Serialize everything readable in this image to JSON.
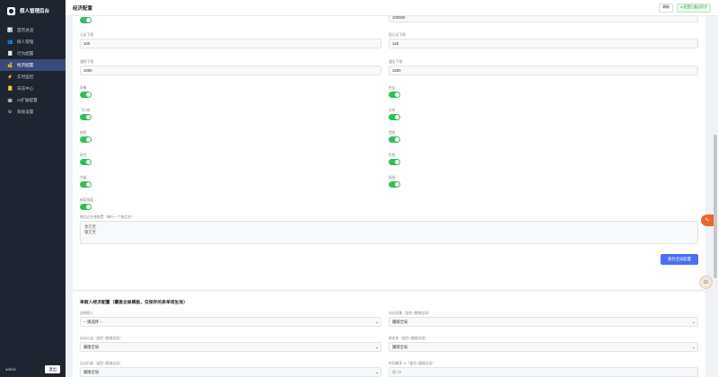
{
  "sidebar": {
    "brand": "假人管理后台",
    "items": [
      {
        "icon": "📊",
        "label": "首页总览"
      },
      {
        "icon": "👥",
        "label": "假人管理"
      },
      {
        "icon": "🧾",
        "label": "行为配置"
      },
      {
        "icon": "💰",
        "label": "经济配置"
      },
      {
        "icon": "⚡",
        "label": "实时监控"
      },
      {
        "icon": "📒",
        "label": "日志中心"
      },
      {
        "icon": "🤖",
        "label": "AI扩展配置"
      },
      {
        "icon": "⚙",
        "label": "系统设置"
      }
    ],
    "user": "admin",
    "logout": "退出"
  },
  "header": {
    "title": "经济配置",
    "refresh": "刷新",
    "status": "● 配置已通过同步"
  },
  "economy": {
    "top_value": "100000",
    "fields": [
      {
        "label": "元宝下限",
        "value": "100"
      },
      {
        "label": "银元宝下限",
        "value": "120"
      },
      {
        "label": "通铜下限",
        "value": "1000"
      },
      {
        "label": "通宝下限",
        "value": "1500"
      }
    ],
    "toggles": [
      "采集",
      "挖宝",
      "飞行棋",
      "击杀",
      "捕鱼",
      "猎鱼",
      "砍伐",
      "钓鱼",
      "升级",
      "锻造",
      "抽奖抽奖"
    ],
    "whitelist_label": "物品白名单配置（每行一个物品名）",
    "whitelist_value": "金元宝\n银元宝",
    "save_label": "保存全局配置"
  },
  "single": {
    "title": "单假人经济配置（覆盖全局模板，仅保存的表单项生效）",
    "fields": [
      {
        "label": "选择假人",
        "value": "-- 请选择 --"
      },
      {
        "label": "自动采集（留空=跟随全局）",
        "value": "跟随全局"
      },
      {
        "label": "自动元宝（留空=跟随全局）",
        "value": "跟随全局"
      },
      {
        "label": "限金条（留空=跟随全局）",
        "value": "跟随全局"
      },
      {
        "label": "自动升级（留空=跟随全局）",
        "value": "跟随全局"
      },
      {
        "label": "时间概率 %（留空=跟随全局）",
        "value": "如 20"
      }
    ]
  },
  "colors": {
    "accent": "#4c6ef5",
    "toggle_on": "#2dbf5a",
    "sidebar": "#1f2530"
  }
}
